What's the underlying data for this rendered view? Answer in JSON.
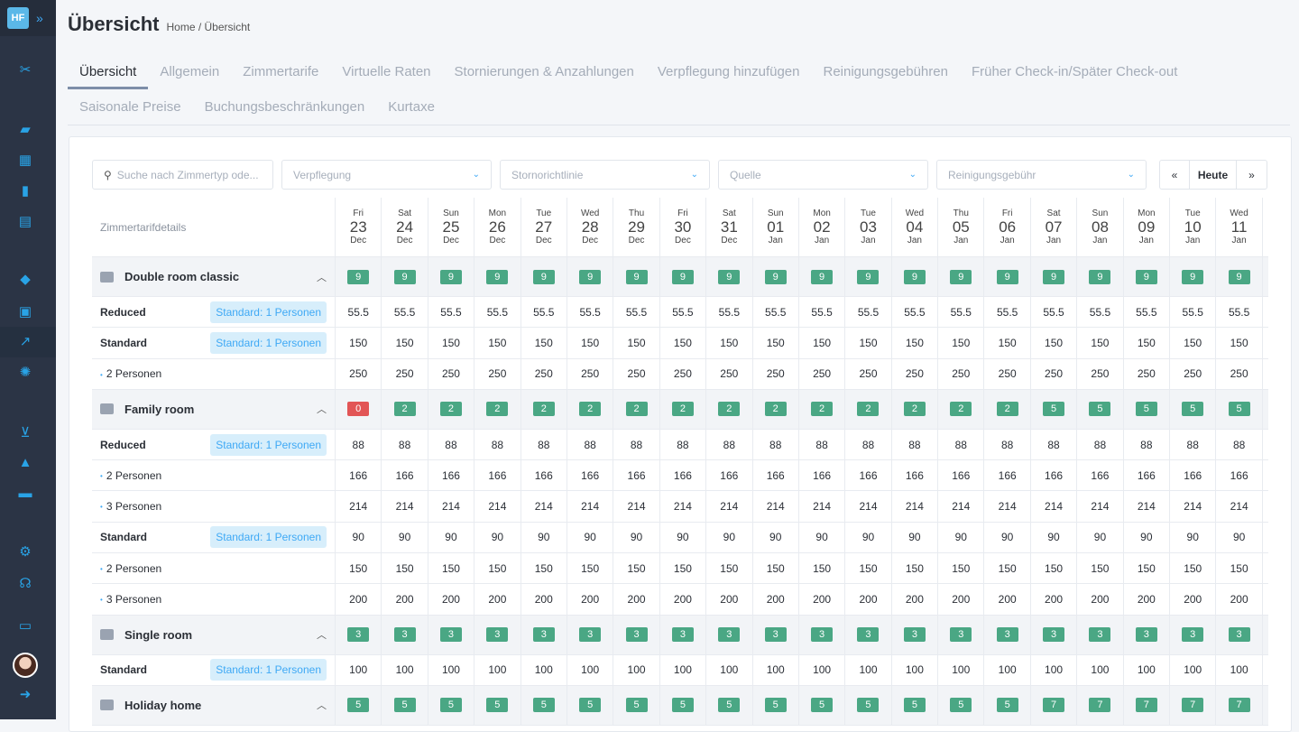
{
  "header": {
    "title": "Übersicht",
    "breadcrumb": [
      "Home",
      "Übersicht"
    ]
  },
  "tabs": [
    [
      "Übersicht",
      "Allgemein",
      "Zimmertarife",
      "Virtuelle Raten",
      "Stornierungen & Anzahlungen",
      "Verpflegung hinzufügen",
      "Reinigungsgebühren",
      "Früher Check-in/Später Check-out"
    ],
    [
      "Saisonale Preise",
      "Buchungsbeschränkungen",
      "Kurtaxe"
    ]
  ],
  "active_tab": "Übersicht",
  "filters": {
    "search_placeholder": "Suche nach Zimmertyp ode...",
    "meal": "Verpflegung",
    "cancellation": "Stornorichtlinie",
    "source": "Quelle",
    "cleaning": "Reinigungsgebühr"
  },
  "nav": {
    "prev": "«",
    "today": "Heute",
    "next": "»"
  },
  "table": {
    "header_label": "Zimmertarifdetails",
    "dates": [
      [
        "Fri",
        "23",
        "Dec"
      ],
      [
        "Sat",
        "24",
        "Dec"
      ],
      [
        "Sun",
        "25",
        "Dec"
      ],
      [
        "Mon",
        "26",
        "Dec"
      ],
      [
        "Tue",
        "27",
        "Dec"
      ],
      [
        "Wed",
        "28",
        "Dec"
      ],
      [
        "Thu",
        "29",
        "Dec"
      ],
      [
        "Fri",
        "30",
        "Dec"
      ],
      [
        "Sat",
        "31",
        "Dec"
      ],
      [
        "Sun",
        "01",
        "Jan"
      ],
      [
        "Mon",
        "02",
        "Jan"
      ],
      [
        "Tue",
        "03",
        "Jan"
      ],
      [
        "Wed",
        "04",
        "Jan"
      ],
      [
        "Thu",
        "05",
        "Jan"
      ],
      [
        "Fri",
        "06",
        "Jan"
      ],
      [
        "Sat",
        "07",
        "Jan"
      ],
      [
        "Sun",
        "08",
        "Jan"
      ],
      [
        "Mon",
        "09",
        "Jan"
      ],
      [
        "Tue",
        "10",
        "Jan"
      ],
      [
        "Wed",
        "11",
        "Jan"
      ]
    ],
    "rooms": [
      {
        "name": "Double room classic",
        "availability": [
          9,
          9,
          9,
          9,
          9,
          9,
          9,
          9,
          9,
          9,
          9,
          9,
          9,
          9,
          9,
          9,
          9,
          9,
          9,
          9
        ],
        "rates": [
          {
            "name": "Reduced",
            "tag": "Standard: 1 Personen",
            "price": "55.5"
          },
          {
            "name": "Standard",
            "tag": "Standard: 1 Personen",
            "price": "150"
          },
          {
            "name": "2 Personen",
            "price": "250"
          }
        ]
      },
      {
        "name": "Family room",
        "availability": [
          0,
          2,
          2,
          2,
          2,
          2,
          2,
          2,
          2,
          2,
          2,
          2,
          2,
          2,
          2,
          5,
          5,
          5,
          5,
          5
        ],
        "rates": [
          {
            "name": "Reduced",
            "tag": "Standard: 1 Personen",
            "price": "88"
          },
          {
            "name": "2 Personen",
            "price": "166"
          },
          {
            "name": "3 Personen",
            "price": "214"
          },
          {
            "name": "Standard",
            "tag": "Standard: 1 Personen",
            "price": "90"
          },
          {
            "name": "2 Personen",
            "price": "150"
          },
          {
            "name": "3 Personen",
            "price": "200"
          }
        ]
      },
      {
        "name": "Single room",
        "availability": [
          3,
          3,
          3,
          3,
          3,
          3,
          3,
          3,
          3,
          3,
          3,
          3,
          3,
          3,
          3,
          3,
          3,
          3,
          3,
          3
        ],
        "rates": [
          {
            "name": "Standard",
            "tag": "Standard: 1 Personen",
            "price": "100"
          }
        ]
      },
      {
        "name": "Holiday home",
        "availability": [
          5,
          5,
          5,
          5,
          5,
          5,
          5,
          5,
          5,
          5,
          5,
          5,
          5,
          5,
          5,
          7,
          7,
          7,
          7,
          7
        ],
        "rates": []
      }
    ]
  },
  "colors": {
    "sidebar": "#2b3445",
    "accent": "#3fa9f5",
    "available": "#4aa784",
    "unavailable": "#e25556"
  }
}
